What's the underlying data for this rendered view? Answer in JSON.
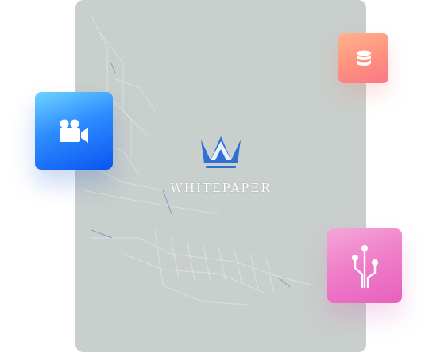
{
  "document": {
    "brand_name": "WHITEPAPER",
    "logo_icon": "crown-icon",
    "background_color": "#c9cfcc",
    "accent_color": "#2f6fd6"
  },
  "tiles": [
    {
      "icon": "video-camera-icon",
      "color": "#2d8cff"
    },
    {
      "icon": "database-icon",
      "color": "#ff8f80"
    },
    {
      "icon": "circuit-icon",
      "color": "#ee7cc8"
    }
  ]
}
